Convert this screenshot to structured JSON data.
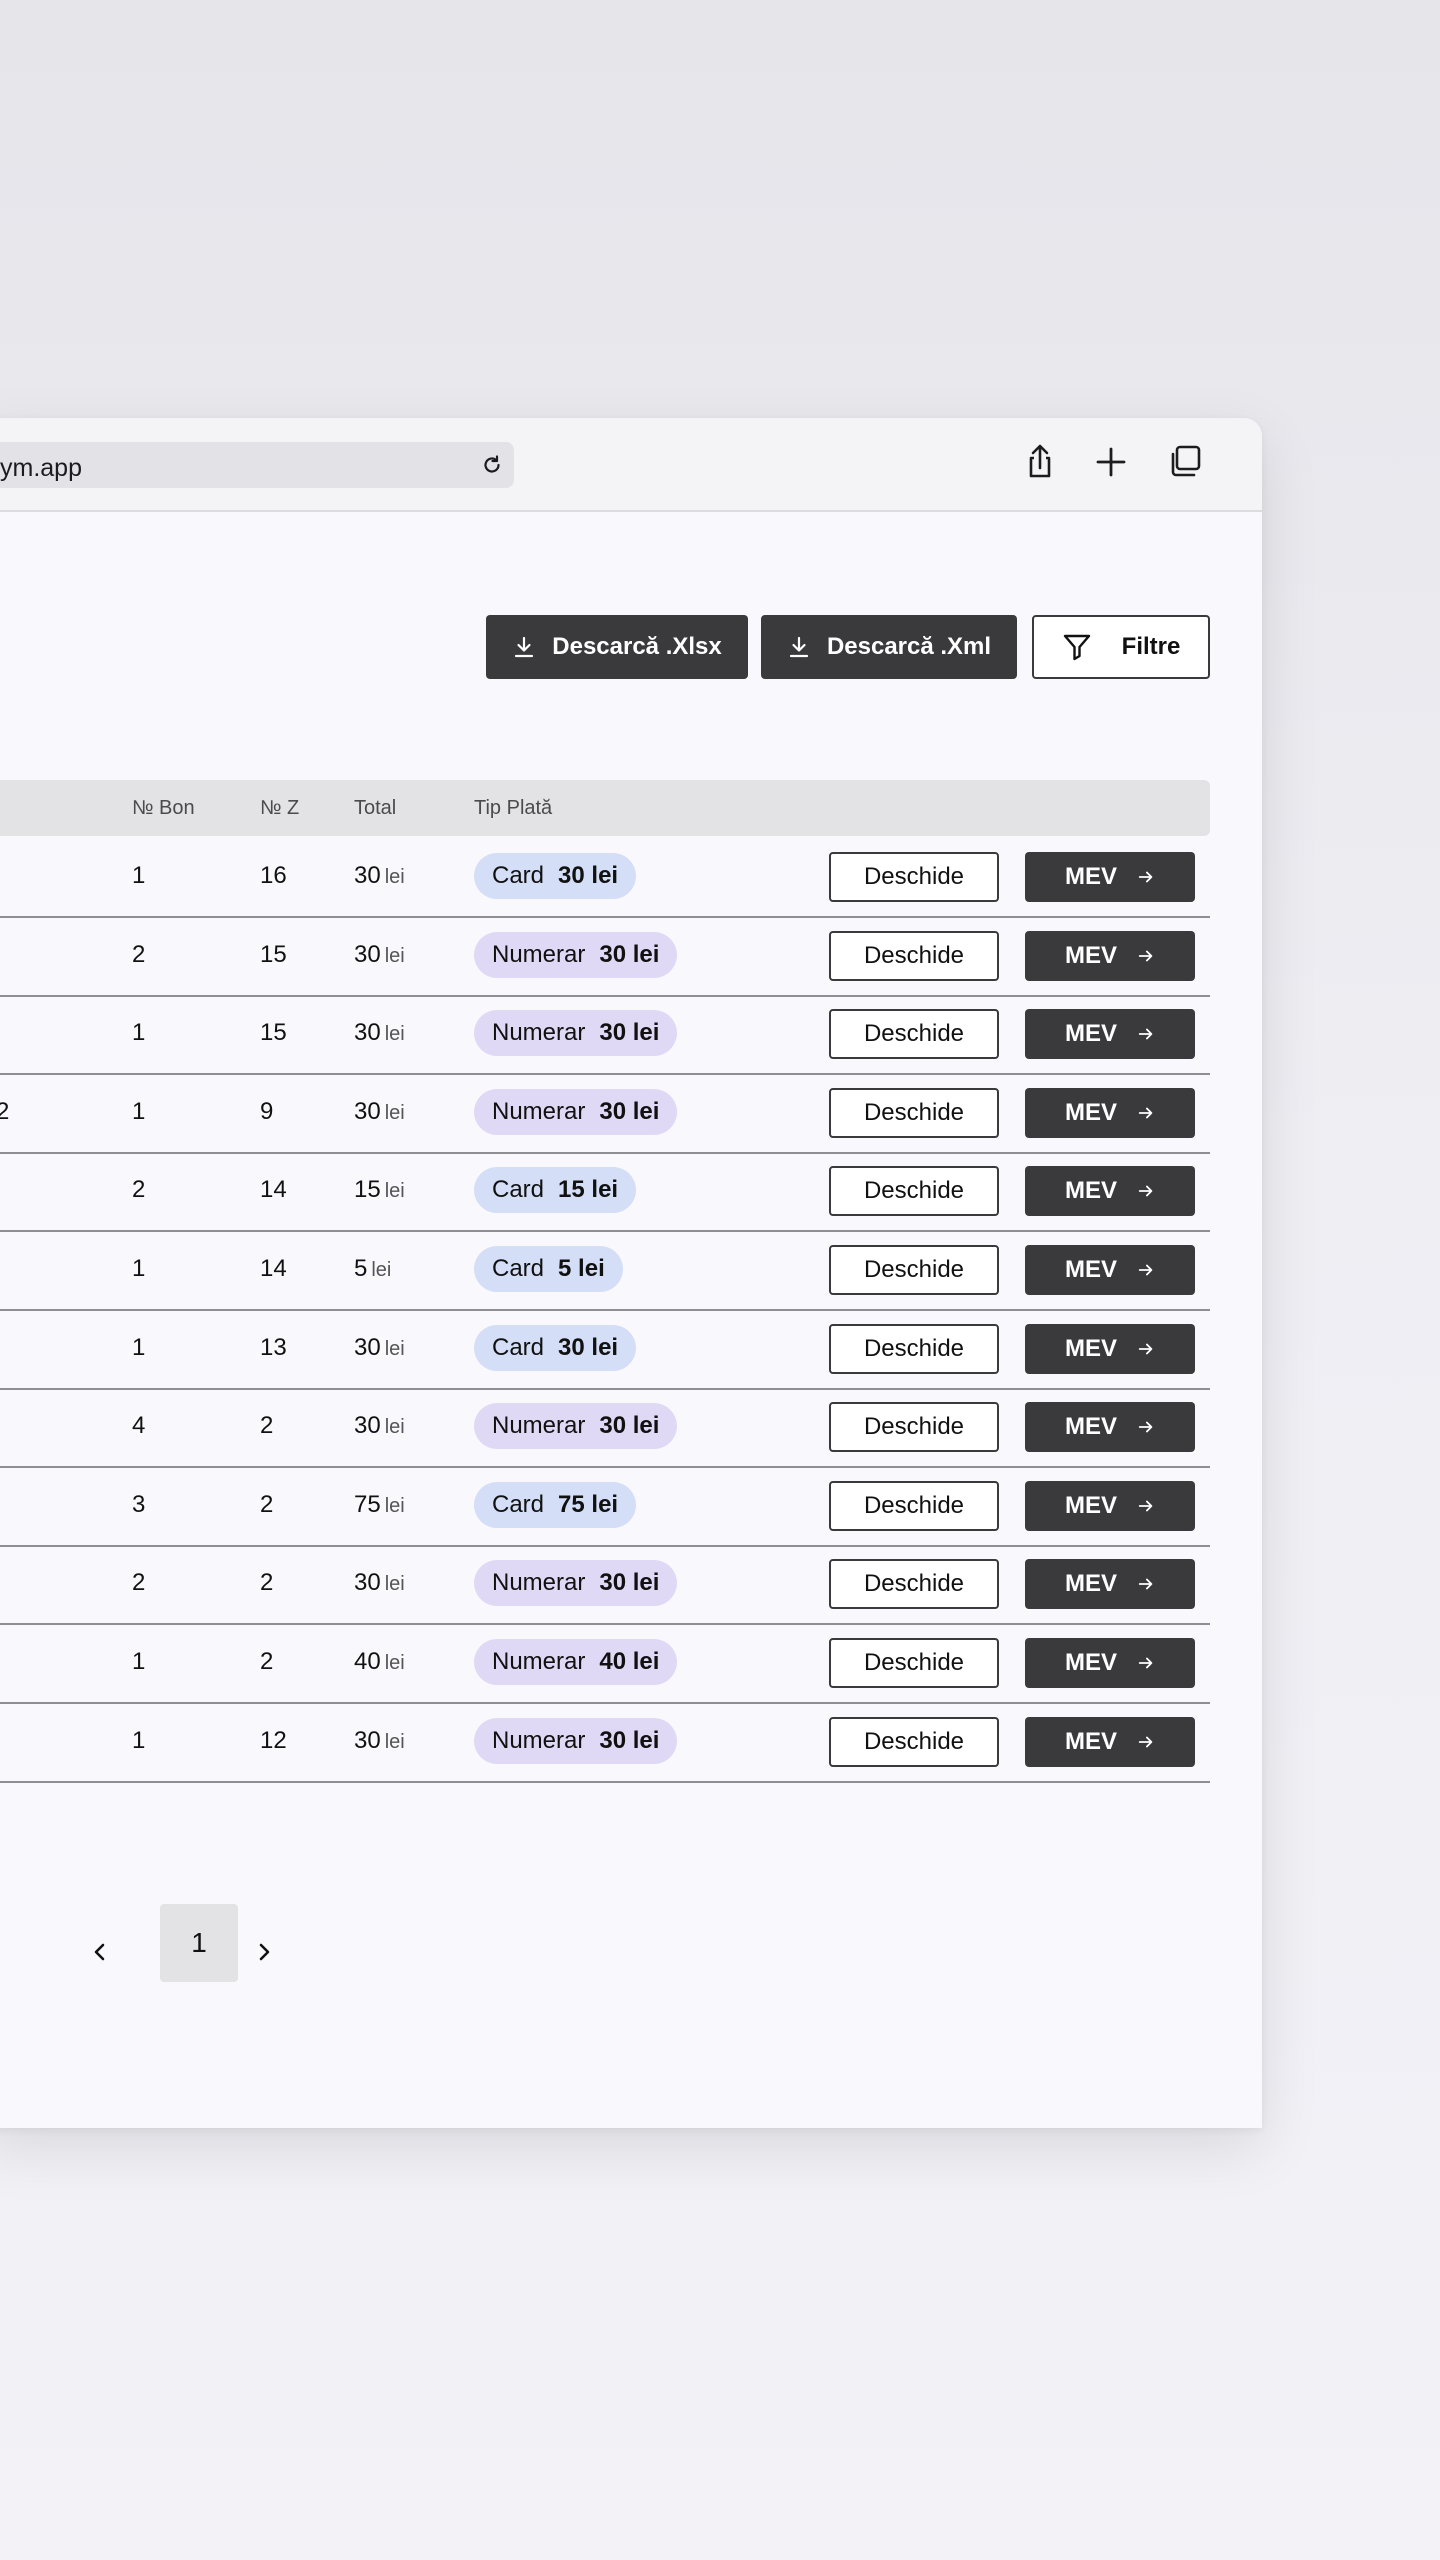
{
  "browser": {
    "url": "ym.app"
  },
  "toolbar": {
    "download_xlsx": "Descarcă .Xlsx",
    "download_xml": "Descarcă .Xml",
    "filters": "Filtre"
  },
  "table": {
    "headers": {
      "bon": "№ Bon",
      "z": "№ Z",
      "total": "Total",
      "payment": "Tip Plată"
    },
    "currency": "lei",
    "open_label": "Deschide",
    "mev_label": "MEV",
    "rows": [
      {
        "leftover": "",
        "bon": "1",
        "z": "16",
        "total": "30",
        "pay_type": "Card",
        "pay_amount": "30 lei",
        "kind": "card"
      },
      {
        "leftover": "",
        "bon": "2",
        "z": "15",
        "total": "30",
        "pay_type": "Numerar",
        "pay_amount": "30 lei",
        "kind": "cash"
      },
      {
        "leftover": "",
        "bon": "1",
        "z": "15",
        "total": "30",
        "pay_type": "Numerar",
        "pay_amount": "30 lei",
        "kind": "cash"
      },
      {
        "leftover": "2",
        "bon": "1",
        "z": "9",
        "total": "30",
        "pay_type": "Numerar",
        "pay_amount": "30 lei",
        "kind": "cash"
      },
      {
        "leftover": "",
        "bon": "2",
        "z": "14",
        "total": "15",
        "pay_type": "Card",
        "pay_amount": "15 lei",
        "kind": "card"
      },
      {
        "leftover": "",
        "bon": "1",
        "z": "14",
        "total": "5",
        "pay_type": "Card",
        "pay_amount": "5 lei",
        "kind": "card"
      },
      {
        "leftover": "",
        "bon": "1",
        "z": "13",
        "total": "30",
        "pay_type": "Card",
        "pay_amount": "30 lei",
        "kind": "card"
      },
      {
        "leftover": "",
        "bon": "4",
        "z": "2",
        "total": "30",
        "pay_type": "Numerar",
        "pay_amount": "30 lei",
        "kind": "cash"
      },
      {
        "leftover": "",
        "bon": "3",
        "z": "2",
        "total": "75",
        "pay_type": "Card",
        "pay_amount": "75 lei",
        "kind": "card"
      },
      {
        "leftover": "",
        "bon": "2",
        "z": "2",
        "total": "30",
        "pay_type": "Numerar",
        "pay_amount": "30 lei",
        "kind": "cash"
      },
      {
        "leftover": "",
        "bon": "1",
        "z": "2",
        "total": "40",
        "pay_type": "Numerar",
        "pay_amount": "40 lei",
        "kind": "cash"
      },
      {
        "leftover": "",
        "bon": "1",
        "z": "12",
        "total": "30",
        "pay_type": "Numerar",
        "pay_amount": "30 lei",
        "kind": "cash"
      }
    ]
  },
  "pagination": {
    "current": "1"
  }
}
